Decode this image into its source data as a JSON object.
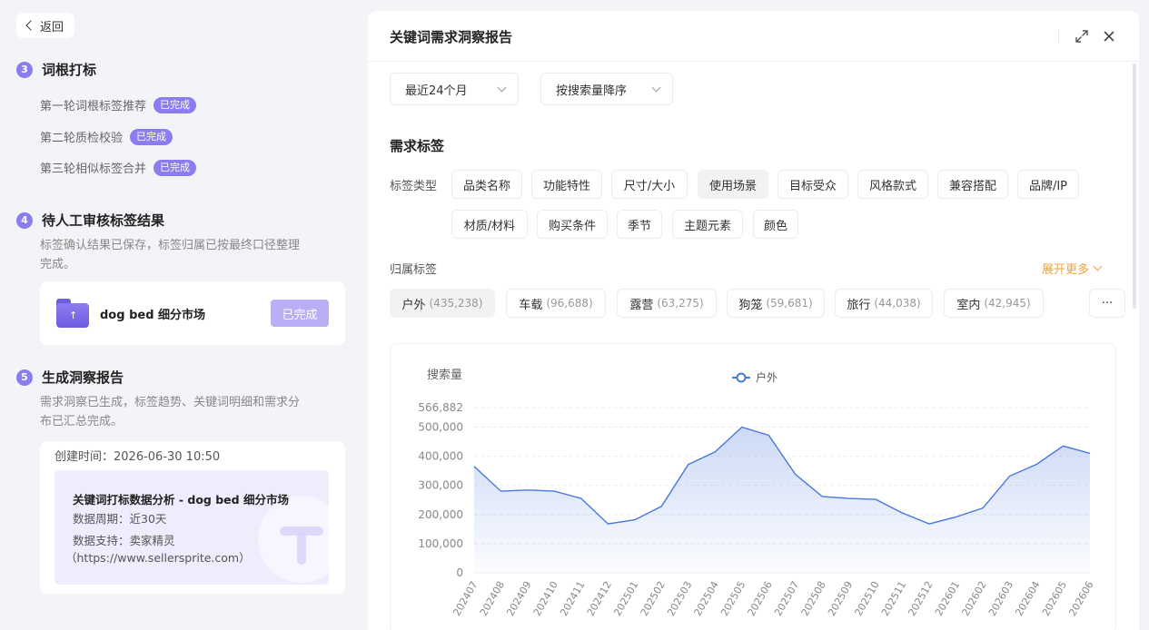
{
  "back": {
    "label": "返回"
  },
  "steps": {
    "s3": {
      "num": "3",
      "title": "词根打标",
      "items": [
        {
          "label": "第一轮词根标签推荐",
          "badge": "已完成"
        },
        {
          "label": "第二轮质检校验",
          "badge": "已完成"
        },
        {
          "label": "第三轮相似标签合并",
          "badge": "已完成"
        }
      ]
    },
    "s4": {
      "num": "4",
      "title": "待人工审核标签结果",
      "desc_line1": "标签确认结果已保存，标签归属已按最终口径整理",
      "desc_line2": "完成。",
      "market": {
        "name": "dog bed 细分市场",
        "button": "已完成"
      }
    },
    "s5": {
      "num": "5",
      "title": "生成洞察报告",
      "desc_line1": "需求洞察已生成，标签趋势、关键词明细和需求分",
      "desc_line2": "布已汇总完成。",
      "created": "创建时间：2026-06-30 10:50",
      "report": {
        "title": "关键词打标数据分析 - dog bed 细分市场",
        "period": "数据周期：近30天",
        "support": "数据支持：卖家精灵",
        "support_url": "（https://www.sellersprite.com）"
      }
    }
  },
  "panel": {
    "title": "关键词需求洞察报告",
    "filters": {
      "period": "最近24个月",
      "sort": "按搜索量降序"
    },
    "section_title": "需求标签",
    "tag_type_label": "标签类型",
    "tag_types": [
      "品类名称",
      "功能特性",
      "尺寸/大小",
      "使用场景",
      "目标受众",
      "风格款式",
      "兼容搭配",
      "品牌/IP",
      "材质/材料",
      "购买条件",
      "季节",
      "主题元素",
      "颜色"
    ],
    "active_tag_type": "使用场景",
    "owned_label": "归属标签",
    "expand_more": "展开更多",
    "owned_tags": [
      {
        "name": "户外",
        "count": "(435,238)"
      },
      {
        "name": "车载",
        "count": "(96,688)"
      },
      {
        "name": "露营",
        "count": "(63,275)"
      },
      {
        "name": "狗笼",
        "count": "(59,681)"
      },
      {
        "name": "旅行",
        "count": "(44,038)"
      },
      {
        "name": "室内",
        "count": "(42,945)"
      }
    ],
    "more_chip": "···"
  },
  "chart_data": {
    "type": "area",
    "ylabel": "搜索量",
    "series_color": "#4a78dc",
    "yticks": [
      "0",
      "100,000",
      "200,000",
      "300,000",
      "400,000",
      "500,000",
      "566,882"
    ],
    "ylim": [
      0,
      566882
    ],
    "x": [
      "202407",
      "202408",
      "202409",
      "202410",
      "202411",
      "202412",
      "202501",
      "202502",
      "202503",
      "202504",
      "202505",
      "202506",
      "202507",
      "202508",
      "202509",
      "202510",
      "202511",
      "202512",
      "202601",
      "202602",
      "202603",
      "202604",
      "202605",
      "202606"
    ],
    "series": [
      {
        "name": "户外",
        "values": [
          365000,
          280000,
          284000,
          280000,
          255000,
          168000,
          182000,
          228000,
          372000,
          415000,
          500000,
          472000,
          338000,
          262000,
          255000,
          252000,
          205000,
          168000,
          192000,
          222000,
          332000,
          372000,
          435000,
          410000
        ]
      }
    ]
  }
}
